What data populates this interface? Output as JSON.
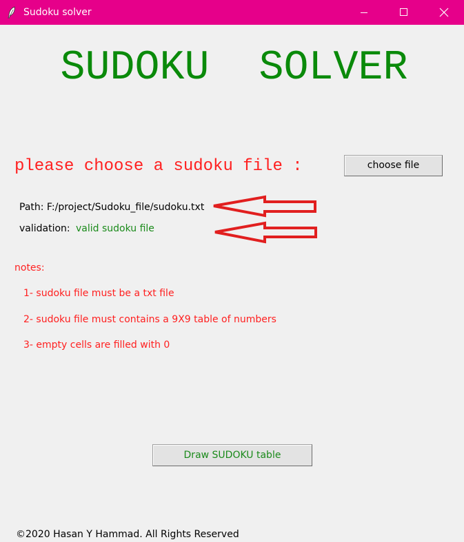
{
  "window": {
    "title": "Sudoku solver",
    "titlebar_color": "#e6008a",
    "controls": [
      "minimize-icon",
      "maximize-icon",
      "close-icon"
    ]
  },
  "header": {
    "title": "SUDOKU  SOLVER",
    "color": "#0a8a0a"
  },
  "file_picker": {
    "prompt": "please choose a sudoku file :",
    "prompt_color": "#ff2020",
    "button_label": "choose file"
  },
  "status": {
    "path_label": "Path: F:/project/Sudoku_file/sudoku.txt",
    "validation_label": "validation:",
    "validation_value": "valid sudoku file",
    "validation_color": "#1a8a1a",
    "annotation_color": "#e11f1f"
  },
  "notes": {
    "title": "notes:",
    "items": [
      "1- sudoku file must be a txt file",
      "2- sudoku file must contains a 9X9 table of numbers",
      "3- empty cells are filled with 0"
    ],
    "color": "#ff2020"
  },
  "actions": {
    "draw_label": "Draw SUDOKU table",
    "draw_color": "#1a8a1a"
  },
  "footer": {
    "text": "©2020 Hasan Y Hammad. All Rights Reserved"
  }
}
